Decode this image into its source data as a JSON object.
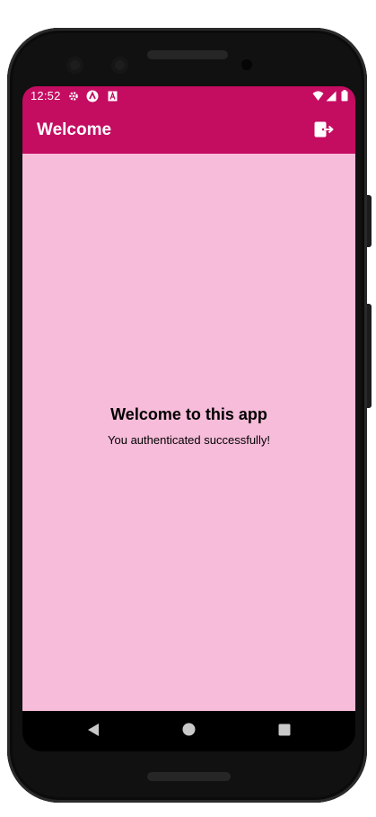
{
  "status_bar": {
    "time": "12:52",
    "left_icons": [
      "settings-icon",
      "app-logo-icon",
      "text-a-icon"
    ],
    "right_icons": [
      "wifi-icon",
      "cellular-signal-icon",
      "battery-icon"
    ]
  },
  "app_bar": {
    "title": "Welcome",
    "action_icon": "logout-icon"
  },
  "main": {
    "heading": "Welcome to this app",
    "message": "You authenticated successfully!"
  },
  "nav_bar": {
    "buttons": [
      "back-icon",
      "home-icon",
      "recents-icon"
    ]
  },
  "colors": {
    "primary": "#c40c61",
    "background": "#f6bcd9",
    "on_primary": "#ffffff"
  }
}
